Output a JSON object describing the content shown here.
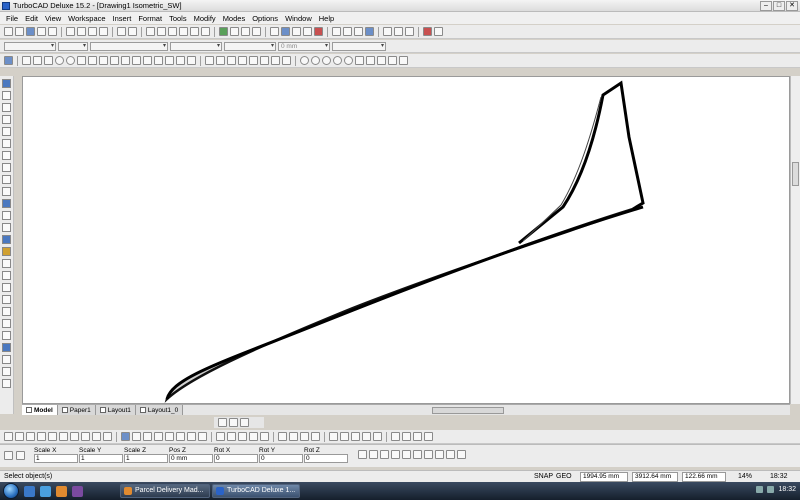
{
  "window": {
    "title": "TurboCAD Deluxe 15.2 - [Drawing1 Isometric_SW]"
  },
  "menu": [
    "File",
    "Edit",
    "View",
    "Workspace",
    "Insert",
    "Format",
    "Tools",
    "Modify",
    "Modes",
    "Options",
    "Window",
    "Help"
  ],
  "property_bar": {
    "thickness_value": "0 mm"
  },
  "tabs": [
    "Model",
    "Paper1",
    "Layout1",
    "Layout1_0"
  ],
  "inspector": {
    "fields": [
      {
        "label": "Scale X",
        "value": "1"
      },
      {
        "label": "Scale Y",
        "value": "1"
      },
      {
        "label": "Scale Z",
        "value": "1"
      },
      {
        "label": "Pos Z",
        "value": "0 mm"
      },
      {
        "label": "Rot X",
        "value": "0"
      },
      {
        "label": "Rot Y",
        "value": "0"
      },
      {
        "label": "Rot Z",
        "value": "0"
      }
    ]
  },
  "status": {
    "message": "Select object(s)",
    "snap": "SNAP",
    "geo": "GEO",
    "coord_x": "1994.95 mm",
    "coord_y": "3912.64 mm",
    "coord_z": "122.66 mm",
    "zoom": "14%",
    "time": "18:32"
  },
  "taskbar": {
    "buttons": [
      "Parcel Delivery Mad...",
      "TurboCAD Deluxe 1..."
    ],
    "time": "18:32"
  },
  "icons": [
    "app-icon",
    "select-arrow-icon",
    "line-tool-icon",
    "circle-tool-icon",
    "snap-icon",
    "start-orb-icon",
    "browser-icon"
  ]
}
